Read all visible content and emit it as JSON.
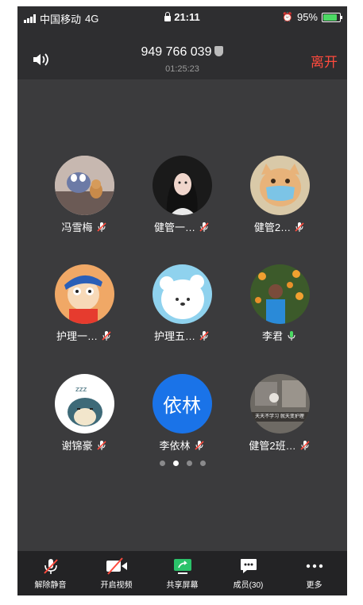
{
  "status": {
    "carrier": "中国移动",
    "network": "4G",
    "time": "21:11",
    "battery": "95%",
    "battery_level": 0.95
  },
  "header": {
    "meeting_id": "949 766 039",
    "duration": "01:25:23",
    "leave_label": "离开",
    "leave_color": "#ff4a3d"
  },
  "participants": [
    {
      "name": "冯雪梅",
      "mic": "muted",
      "avatar": "cartoon-cat-mouse"
    },
    {
      "name": "健管一…",
      "mic": "muted",
      "avatar": "girl-photo"
    },
    {
      "name": "健管2…",
      "mic": "muted",
      "avatar": "cat-with-mask"
    },
    {
      "name": "护理一…",
      "mic": "muted",
      "avatar": "crayon-shin-chan"
    },
    {
      "name": "护理五…",
      "mic": "muted",
      "avatar": "white-bear"
    },
    {
      "name": "李君",
      "mic": "active",
      "avatar": "person-with-flowers"
    },
    {
      "name": "谢锦豪",
      "mic": "muted",
      "avatar": "sleeping-snorlax"
    },
    {
      "name": "李依林",
      "mic": "muted",
      "avatar_text": "依林",
      "avatar_color": "#1a73e8"
    },
    {
      "name": "健管2班…",
      "mic": "muted",
      "avatar": "sticker-meme",
      "avatar_caption": "天天不学习 就天变护理"
    }
  ],
  "pagination": {
    "pages": 4,
    "current": 2
  },
  "toolbar": [
    {
      "label": "解除静音",
      "icon": "muted-mic-icon"
    },
    {
      "label": "开启视频",
      "icon": "video-off-icon"
    },
    {
      "label": "共享屏幕",
      "icon": "share-screen-icon"
    },
    {
      "label": "成员(30)",
      "icon": "members-chat-icon"
    },
    {
      "label": "更多",
      "icon": "more-icon"
    }
  ]
}
